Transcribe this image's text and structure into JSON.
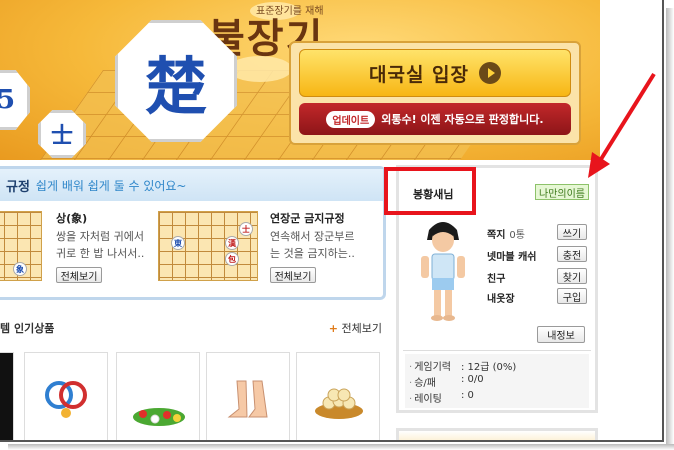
{
  "banner": {
    "brand_top": "표준장기를 재해",
    "brand_title": "불장기",
    "big_piece": "楚",
    "small_piece": "士",
    "edge_piece": "5",
    "enter_label": "대국실 입장",
    "update_badge": "업데이트",
    "update_text": "외통수! 이젠 자동으로 판정합니다."
  },
  "rules": {
    "title": "규정",
    "subtitle": "쉽게 배워 쉽게 둘 수 있어요~",
    "cards": [
      {
        "name": "상(象)",
        "desc_1": "쌍을 자처럼 귀에서",
        "desc_2": "귀로 한 밥 나서서..",
        "button": "전체보기"
      },
      {
        "name": "연장군 금지규정",
        "desc_1": "연속해서 장군부르",
        "desc_2": "는 것을 금지하는..",
        "button": "전체보기"
      }
    ],
    "thumb1_piece": "象",
    "thumb2_pieces": [
      "士",
      "漢",
      "東",
      "包"
    ]
  },
  "popular": {
    "title": "템 인기상품",
    "more_plus": "+",
    "more_label": "전체보기"
  },
  "profile": {
    "name": "봉황새님",
    "myname_button": "나만의이름",
    "stats": [
      {
        "label": "쪽지",
        "value": "0통",
        "button": "쓰기"
      },
      {
        "label": "넷마블 캐쉬",
        "value": "",
        "button": "충전"
      },
      {
        "label": "친구",
        "value": "",
        "button": "찾기"
      },
      {
        "label": "내옷장",
        "value": "",
        "button": "구입"
      }
    ],
    "info_button": "내정보",
    "info": [
      {
        "label": "게임기력",
        "value": ": 12급 (0%)"
      },
      {
        "label": "승/패",
        "value": ": 0/0"
      },
      {
        "label": "레이팅",
        "value": ": 0"
      }
    ]
  },
  "colors": {
    "annotation_red": "#e8141c",
    "banner_orange": "#f6b93a",
    "rules_blue": "#2e86c9"
  }
}
